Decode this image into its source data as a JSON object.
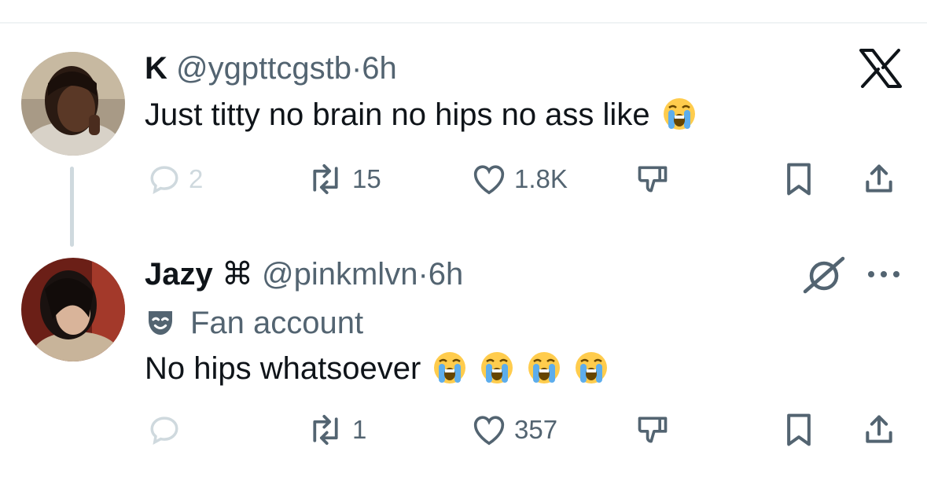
{
  "tweets": [
    {
      "name": "K",
      "handle": "@ygpttcgstb",
      "separator": "·",
      "time": "6h",
      "text": "Just titty no brain no hips no ass like",
      "emojis": [
        "loudly-crying-face"
      ],
      "stats": {
        "replies": "2",
        "reposts": "15",
        "likes": "1.8K"
      }
    },
    {
      "name": "Jazy",
      "name_symbol": "⌘",
      "handle": "@pinkmlvn",
      "separator": "·",
      "time": "6h",
      "label": "Fan account",
      "text": "No hips whatsoever",
      "emojis": [
        "loudly-crying-face",
        "loudly-crying-face",
        "loudly-crying-face",
        "loudly-crying-face"
      ],
      "stats": {
        "replies": "",
        "reposts": "1",
        "likes": "357"
      }
    }
  ],
  "icons": [
    "reply-icon",
    "repost-icon",
    "like-icon",
    "downvote-icon",
    "bookmark-icon",
    "share-icon",
    "x-logo-icon",
    "grok-icon",
    "more-icon",
    "fan-account-mask-icon"
  ],
  "colors": {
    "text": "#0f1419",
    "secondary": "#536471",
    "divider": "#eff3f4",
    "thread": "#cfd9de",
    "reply_faded": "#cfd9de"
  }
}
